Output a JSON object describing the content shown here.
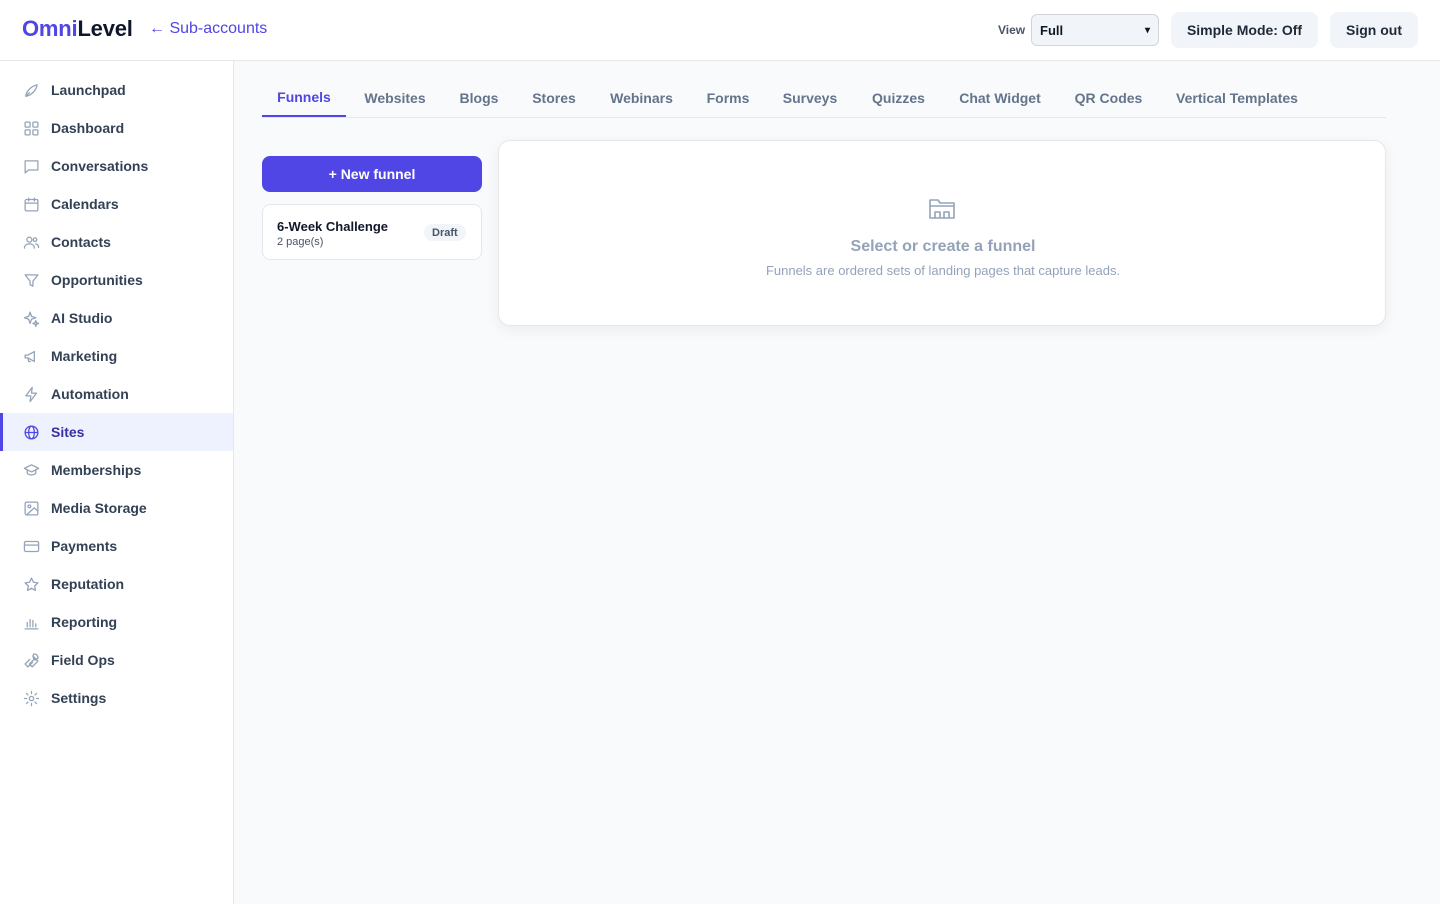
{
  "app": {
    "brand_part1": "Omni",
    "brand_part2": "Level",
    "back_link": "← Sub-accounts"
  },
  "header": {
    "view_label": "View",
    "view_value": "Full",
    "simple_mode": "Simple Mode: Off",
    "sign_out": "Sign out"
  },
  "colors": {
    "accent": "#4f46e5",
    "active_bg": "#eef2ff",
    "muted_text": "#94a3b8"
  },
  "sidebar": {
    "active": "Sites",
    "items": [
      {
        "label": "Launchpad",
        "icon": "rocket-icon"
      },
      {
        "label": "Dashboard",
        "icon": "grid-icon"
      },
      {
        "label": "Conversations",
        "icon": "chat-icon"
      },
      {
        "label": "Calendars",
        "icon": "calendar-icon"
      },
      {
        "label": "Contacts",
        "icon": "users-icon"
      },
      {
        "label": "Opportunities",
        "icon": "filter-icon"
      },
      {
        "label": "AI Studio",
        "icon": "sparkles-icon"
      },
      {
        "label": "Marketing",
        "icon": "megaphone-icon"
      },
      {
        "label": "Automation",
        "icon": "bolt-icon"
      },
      {
        "label": "Sites",
        "icon": "globe-icon"
      },
      {
        "label": "Memberships",
        "icon": "graduation-cap-icon"
      },
      {
        "label": "Media Storage",
        "icon": "image-icon"
      },
      {
        "label": "Payments",
        "icon": "credit-card-icon"
      },
      {
        "label": "Reputation",
        "icon": "star-icon"
      },
      {
        "label": "Reporting",
        "icon": "bar-chart-icon"
      },
      {
        "label": "Field Ops",
        "icon": "wrench-icon"
      },
      {
        "label": "Settings",
        "icon": "gear-icon"
      }
    ]
  },
  "tabs": {
    "active": "Funnels",
    "items": [
      "Funnels",
      "Websites",
      "Blogs",
      "Stores",
      "Webinars",
      "Forms",
      "Surveys",
      "Quizzes",
      "Chat Widget",
      "QR Codes",
      "Vertical Templates"
    ]
  },
  "funnels": {
    "new_button": "+ New funnel",
    "list": [
      {
        "name": "6-Week Challenge",
        "pages": "2 page(s)",
        "status": "Draft"
      }
    ]
  },
  "empty_state": {
    "icon": "folder-icon",
    "title": "Select or create a funnel",
    "subtitle": "Funnels are ordered sets of landing pages that capture leads."
  }
}
